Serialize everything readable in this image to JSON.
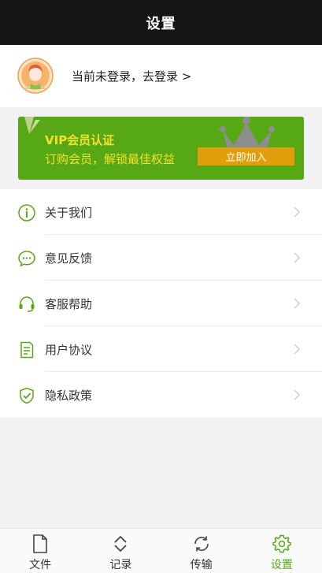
{
  "header": {
    "title": "设置"
  },
  "user": {
    "login_prompt": "当前未登录，去登录 >"
  },
  "vip": {
    "title": "VIP会员认证",
    "subtitle": "订购会员，解锁最佳权益",
    "join_label": "立即加入",
    "colors": {
      "card": "#56a814",
      "text": "#f3e12a",
      "button": "#e09e0a"
    }
  },
  "menu": {
    "items": [
      {
        "label": "关于我们",
        "icon": "info-icon"
      },
      {
        "label": "意见反馈",
        "icon": "chat-bubble-icon"
      },
      {
        "label": "客服帮助",
        "icon": "headset-icon"
      },
      {
        "label": "用户协议",
        "icon": "document-icon"
      },
      {
        "label": "隐私政策",
        "icon": "shield-check-icon"
      }
    ]
  },
  "tabbar": {
    "tabs": [
      {
        "label": "文件",
        "icon": "file-icon",
        "active": false
      },
      {
        "label": "记录",
        "icon": "up-down-chevrons-icon",
        "active": false
      },
      {
        "label": "传输",
        "icon": "sync-icon",
        "active": false
      },
      {
        "label": "设置",
        "icon": "gear-icon",
        "active": true
      }
    ],
    "accent": "#56a814"
  }
}
